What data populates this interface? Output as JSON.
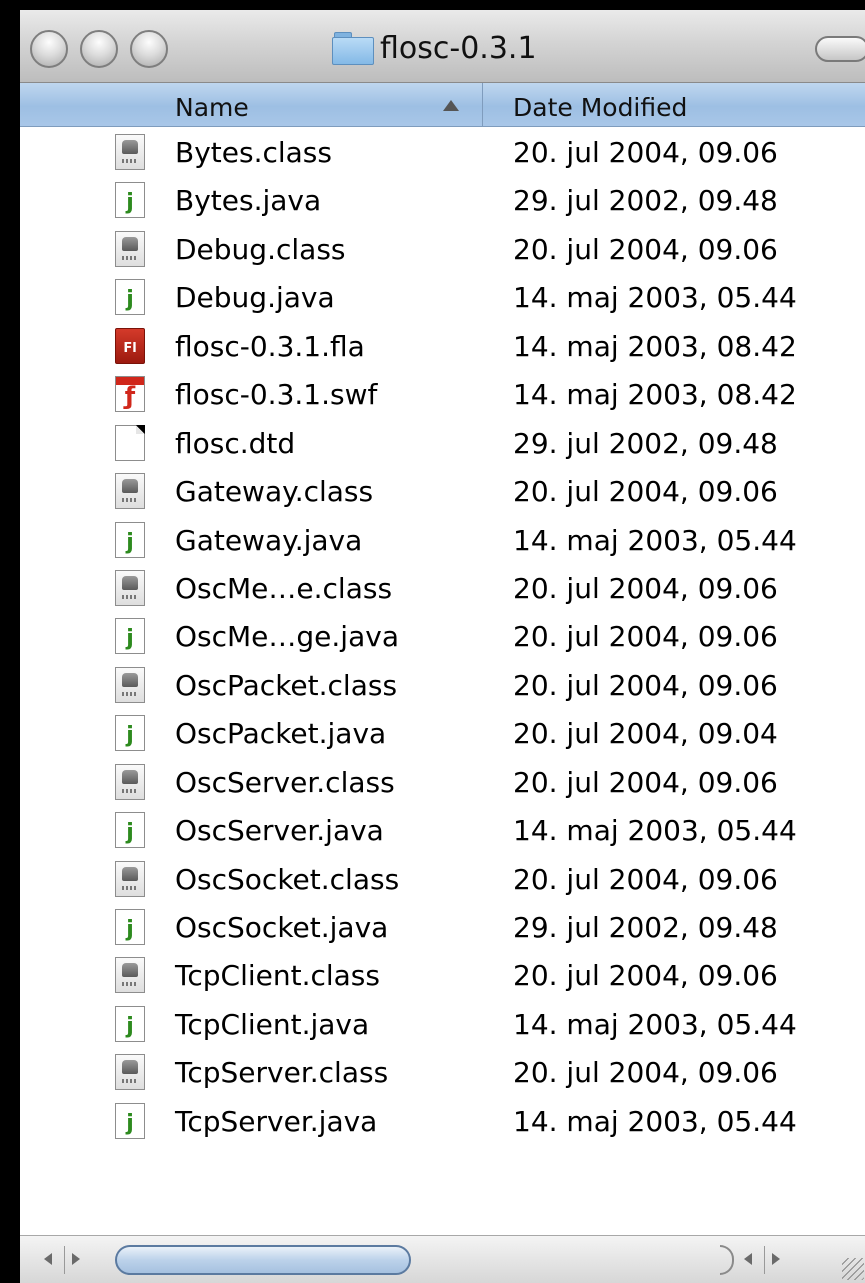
{
  "window": {
    "title": "flosc-0.3.1"
  },
  "columns": {
    "name": "Name",
    "date_modified": "Date Modified",
    "sort_direction": "ascending"
  },
  "files": [
    {
      "name": "Bytes.class",
      "date": "20. jul 2004, 09.06",
      "icon": "class-file-icon"
    },
    {
      "name": "Bytes.java",
      "date": "29. jul 2002, 09.48",
      "icon": "java-file-icon"
    },
    {
      "name": "Debug.class",
      "date": "20. jul 2004, 09.06",
      "icon": "class-file-icon"
    },
    {
      "name": "Debug.java",
      "date": "14. maj 2003, 05.44",
      "icon": "java-file-icon"
    },
    {
      "name": "flosc-0.3.1.fla",
      "date": "14. maj 2003, 08.42",
      "icon": "flash-fla-icon"
    },
    {
      "name": "flosc-0.3.1.swf",
      "date": "14. maj 2003, 08.42",
      "icon": "flash-swf-icon"
    },
    {
      "name": "flosc.dtd",
      "date": "29. jul 2002, 09.48",
      "icon": "document-icon"
    },
    {
      "name": "Gateway.class",
      "date": "20. jul 2004, 09.06",
      "icon": "class-file-icon"
    },
    {
      "name": "Gateway.java",
      "date": "14. maj 2003, 05.44",
      "icon": "java-file-icon"
    },
    {
      "name": "OscMe…e.class",
      "date": "20. jul 2004, 09.06",
      "icon": "class-file-icon"
    },
    {
      "name": "OscMe…ge.java",
      "date": "20. jul 2004, 09.06",
      "icon": "java-file-icon"
    },
    {
      "name": "OscPacket.class",
      "date": "20. jul 2004, 09.06",
      "icon": "class-file-icon"
    },
    {
      "name": "OscPacket.java",
      "date": "20. jul 2004, 09.04",
      "icon": "java-file-icon"
    },
    {
      "name": "OscServer.class",
      "date": "20. jul 2004, 09.06",
      "icon": "class-file-icon"
    },
    {
      "name": "OscServer.java",
      "date": "14. maj 2003, 05.44",
      "icon": "java-file-icon"
    },
    {
      "name": "OscSocket.class",
      "date": "20. jul 2004, 09.06",
      "icon": "class-file-icon"
    },
    {
      "name": "OscSocket.java",
      "date": "29. jul 2002, 09.48",
      "icon": "java-file-icon"
    },
    {
      "name": "TcpClient.class",
      "date": "20. jul 2004, 09.06",
      "icon": "class-file-icon"
    },
    {
      "name": "TcpClient.java",
      "date": "14. maj 2003, 05.44",
      "icon": "java-file-icon"
    },
    {
      "name": "TcpServer.class",
      "date": "20. jul 2004, 09.06",
      "icon": "class-file-icon"
    },
    {
      "name": "TcpServer.java",
      "date": "14. maj 2003, 05.44",
      "icon": "java-file-icon"
    }
  ],
  "icons": {
    "java_glyph": "j",
    "fla_glyph": "Fl",
    "swf_glyph": "ƒ"
  },
  "colors": {
    "header_blue": "#a9c7e8",
    "java_green": "#2d8a1e",
    "flash_red": "#d0271b"
  }
}
